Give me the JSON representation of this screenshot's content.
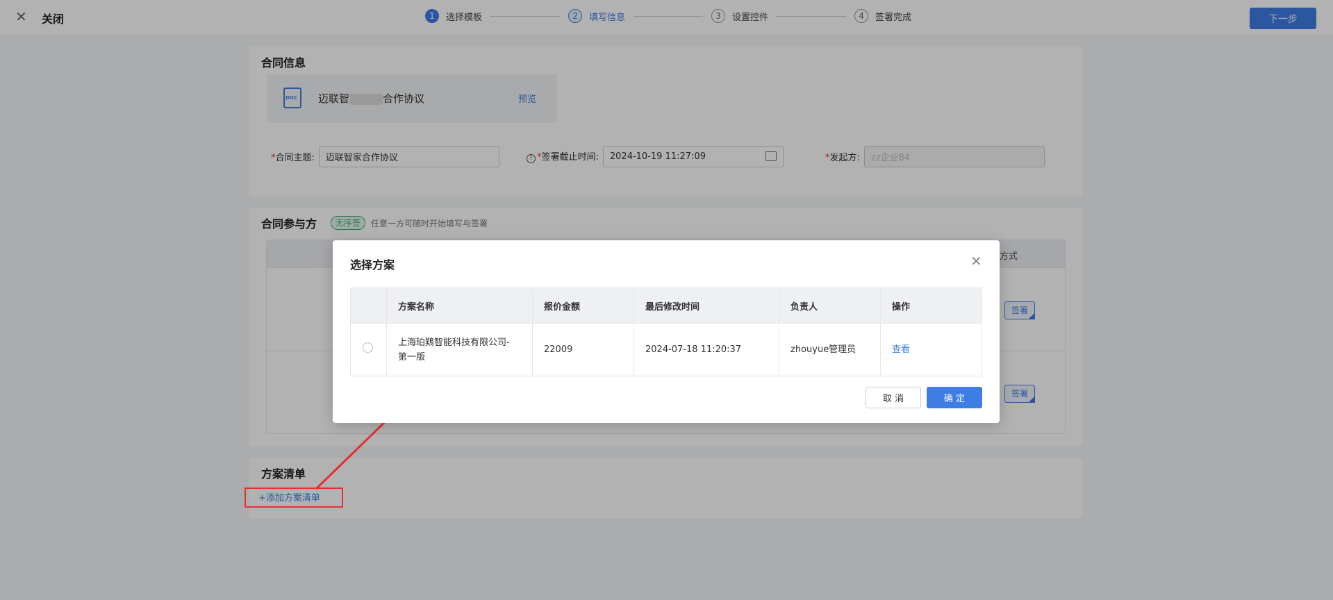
{
  "header": {
    "close_label": "关闭",
    "next_label": "下一步",
    "steps": [
      {
        "num": "1",
        "label": "选择模板"
      },
      {
        "num": "2",
        "label": "填写信息"
      },
      {
        "num": "3",
        "label": "设置控件"
      },
      {
        "num": "4",
        "label": "签署完成"
      }
    ]
  },
  "contract_info": {
    "title": "合同信息",
    "file_icon_text": "DOC",
    "file_name_prefix": "迈联智",
    "file_name_suffix": "合作协议",
    "preview_label": "预览",
    "subject_label": "合同主题:",
    "subject_value": "迈联智家合作协议",
    "deadline_info_icon": "!",
    "deadline_label": "签署截止时间:",
    "deadline_value": "2024-10-19 11:27:09",
    "initiator_label": "发起方:",
    "initiator_placeholder": "zz企业84",
    "required_mark": "*"
  },
  "parties": {
    "title": "合同参与方",
    "badge": "无序签",
    "tip": "任意一方可随时开始填写与签署",
    "column_header_partial": "方式",
    "sign_tag": "签署"
  },
  "plan_list": {
    "title": "方案清单",
    "add_label": "+添加方案清单"
  },
  "modal": {
    "title": "选择方案",
    "columns": [
      "方案名称",
      "报价金额",
      "最后修改时间",
      "负责人",
      "操作"
    ],
    "rows": [
      {
        "name_line1": "上海珀䴆智能科技有限公司-",
        "name_line2": "第一版",
        "amount": "22009",
        "modified": "2024-07-18 11:20:37",
        "owner": "zhouyue管理员",
        "action": "查看"
      }
    ],
    "cancel_label": "取 消",
    "ok_label": "确 定"
  },
  "colors": {
    "primary": "#3d7de4",
    "annotation_red": "#e53030",
    "badge_green": "#3aa76d"
  }
}
